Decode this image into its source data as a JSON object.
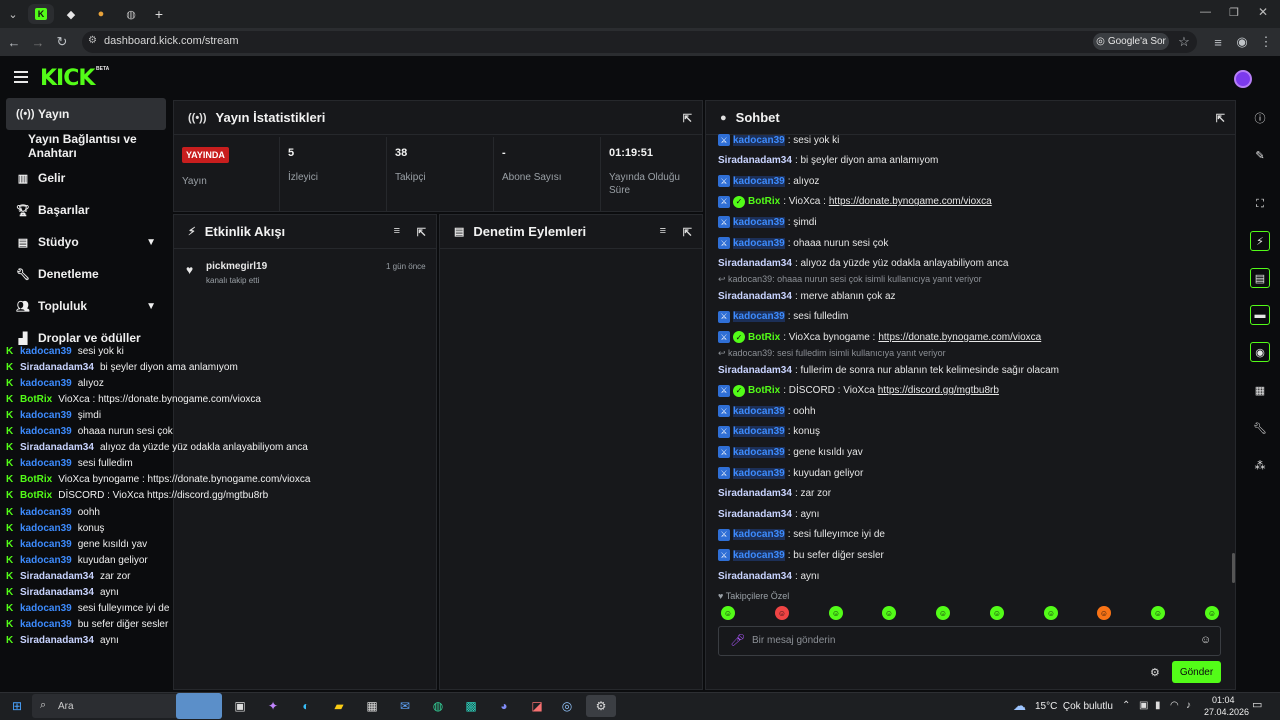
{
  "browser": {
    "url": "dashboard.kick.com/stream",
    "ask_google": "Google'a Sor"
  },
  "sidebar": {
    "items": [
      {
        "label": "Yayın",
        "icon": "broadcast-icon"
      },
      {
        "label": "Yayın Bağlantısı ve Anahtarı",
        "icon": ""
      },
      {
        "label": "Gelir",
        "icon": "chart-icon"
      },
      {
        "label": "Başarılar",
        "icon": "trophy-icon"
      },
      {
        "label": "Stüdyo",
        "icon": "studio-icon"
      },
      {
        "label": "Denetleme",
        "icon": "wrench-icon"
      },
      {
        "label": "Topluluk",
        "icon": "community-icon"
      },
      {
        "label": "Droplar ve ödüller",
        "icon": "gift-icon"
      }
    ]
  },
  "stats_panel": {
    "title": "Yayın İstatistikleri",
    "live_badge": "YAYINDA",
    "items": [
      {
        "value": "",
        "label": "Yayın"
      },
      {
        "value": "5",
        "label": "İzleyici"
      },
      {
        "value": "38",
        "label": "Takipçi"
      },
      {
        "value": "-",
        "label": "Abone Sayısı"
      },
      {
        "value": "01:19:51",
        "label": "Yayında Olduğu Süre"
      }
    ]
  },
  "activity_panel": {
    "title": "Etkinlik Akışı",
    "events": [
      {
        "user": "pickmegirl19",
        "action": "kanalı takip etti",
        "time": "1 gün önce"
      }
    ]
  },
  "moderation_panel": {
    "title": "Denetim Eylemleri"
  },
  "overlay_chat": [
    {
      "user": "kadocan39",
      "color": "#3d8bfd",
      "msg": "sesi yok ki"
    },
    {
      "user": "Siradanadam34",
      "color": "#c9d4ff",
      "msg": "bi şeyler diyon ama anlamıyom"
    },
    {
      "user": "kadocan39",
      "color": "#3d8bfd",
      "msg": "alıyoz"
    },
    {
      "user": "BotRix",
      "color": "#53fc18",
      "msg": "VioXca : https://donate.bynogame.com/vioxca"
    },
    {
      "user": "kadocan39",
      "color": "#3d8bfd",
      "msg": "şimdi"
    },
    {
      "user": "kadocan39",
      "color": "#3d8bfd",
      "msg": "ohaaa nurun sesi çok"
    },
    {
      "user": "Siradanadam34",
      "color": "#c9d4ff",
      "msg": "alıyoz da yüzde yüz odakla anlayabiliyom anca"
    },
    {
      "user": "kadocan39",
      "color": "#3d8bfd",
      "msg": "sesi fulledim"
    },
    {
      "user": "BotRix",
      "color": "#53fc18",
      "msg": "VioXca bynogame : https://donate.bynogame.com/vioxca"
    },
    {
      "user": "BotRix",
      "color": "#53fc18",
      "msg": "DİSCORD : VioXca https://discord.gg/mgtbu8rb"
    },
    {
      "user": "kadocan39",
      "color": "#3d8bfd",
      "msg": "oohh"
    },
    {
      "user": "kadocan39",
      "color": "#3d8bfd",
      "msg": "konuş"
    },
    {
      "user": "kadocan39",
      "color": "#3d8bfd",
      "msg": "gene kısıldı yav"
    },
    {
      "user": "kadocan39",
      "color": "#3d8bfd",
      "msg": "kuyudan geliyor"
    },
    {
      "user": "Siradanadam34",
      "color": "#c9d4ff",
      "msg": "zar zor"
    },
    {
      "user": "Siradanadam34",
      "color": "#c9d4ff",
      "msg": "aynı"
    },
    {
      "user": "kadocan39",
      "color": "#3d8bfd",
      "msg": "sesi fulleyımce iyi de"
    },
    {
      "user": "kadocan39",
      "color": "#3d8bfd",
      "msg": "bu sefer diğer sesler"
    },
    {
      "user": "Siradanadam34",
      "color": "#c9d4ff",
      "msg": "aynı"
    }
  ],
  "chat": {
    "title": "Sohbet",
    "messages": [
      {
        "badge": "mod",
        "user": "kadocan39",
        "color": "#3d8bfd",
        "msg": ": sesi yok ki"
      },
      {
        "badge": "",
        "user": "Siradanadam34",
        "color": "#c9d4ff",
        "msg": ": bi şeyler diyon ama anlamıyom"
      },
      {
        "badge": "mod",
        "user": "kadocan39",
        "color": "#3d8bfd",
        "msg": ": alıyoz"
      },
      {
        "badge": "bot",
        "user": "BotRix",
        "color": "#53fc18",
        "msg": ": VioXca : ",
        "link": "https://donate.bynogame.com/vioxca"
      },
      {
        "badge": "mod",
        "user": "kadocan39",
        "color": "#3d8bfd",
        "msg": ": şimdi"
      },
      {
        "badge": "mod",
        "user": "kadocan39",
        "color": "#3d8bfd",
        "msg": ": ohaaa nurun sesi çok"
      },
      {
        "badge": "",
        "user": "Siradanadam34",
        "color": "#c9d4ff",
        "msg": ": alıyoz da yüzde yüz odakla anlayabiliyom anca"
      },
      {
        "badge": "",
        "user": "Siradanadam34",
        "color": "#c9d4ff",
        "msg": ": merve ablanın çok az",
        "reply": "kadocan39: ohaaa nurun sesi çok isimli kullanıcıya yanıt veriyor"
      },
      {
        "badge": "mod",
        "user": "kadocan39",
        "color": "#3d8bfd",
        "msg": ": sesi fulledim"
      },
      {
        "badge": "bot",
        "user": "BotRix",
        "color": "#53fc18",
        "msg": ": VioXca bynogame : ",
        "link": "https://donate.bynogame.com/vioxca"
      },
      {
        "badge": "",
        "user": "Siradanadam34",
        "color": "#c9d4ff",
        "msg": ": fullerim de sonra nur ablanın tek kelimesinde sağır olacam",
        "reply": "kadocan39: sesi fulledim isimli kullanıcıya yanıt veriyor"
      },
      {
        "badge": "bot",
        "user": "BotRix",
        "color": "#53fc18",
        "msg": ": DİSCORD : VioXca ",
        "link": "https://discord.gg/mgtbu8rb"
      },
      {
        "badge": "mod",
        "user": "kadocan39",
        "color": "#3d8bfd",
        "msg": ": oohh"
      },
      {
        "badge": "mod",
        "user": "kadocan39",
        "color": "#3d8bfd",
        "msg": ": konuş"
      },
      {
        "badge": "mod",
        "user": "kadocan39",
        "color": "#3d8bfd",
        "msg": ": gene kısıldı yav"
      },
      {
        "badge": "mod",
        "user": "kadocan39",
        "color": "#3d8bfd",
        "msg": ": kuyudan geliyor"
      },
      {
        "badge": "",
        "user": "Siradanadam34",
        "color": "#c9d4ff",
        "msg": ": zar zor"
      },
      {
        "badge": "",
        "user": "Siradanadam34",
        "color": "#c9d4ff",
        "msg": ": aynı"
      },
      {
        "badge": "mod",
        "user": "kadocan39",
        "color": "#3d8bfd",
        "msg": ": sesi fulleyımce iyi de"
      },
      {
        "badge": "mod",
        "user": "kadocan39",
        "color": "#3d8bfd",
        "msg": ": bu sefer diğer sesler"
      },
      {
        "badge": "",
        "user": "Siradanadam34",
        "color": "#c9d4ff",
        "msg": ": aynı"
      }
    ],
    "emote_label": "Takipçilere Özel",
    "input_placeholder": "Bir mesaj gönderin",
    "send_label": "Gönder"
  },
  "taskbar": {
    "search_placeholder": "Ara",
    "weather": "15°C  Çok bulutlu",
    "time": "01:04",
    "date": "27.04.2026"
  },
  "colors": {
    "accent": "#53fc18",
    "live": "#c81e1e",
    "mod_user": "#3d8bfd"
  }
}
